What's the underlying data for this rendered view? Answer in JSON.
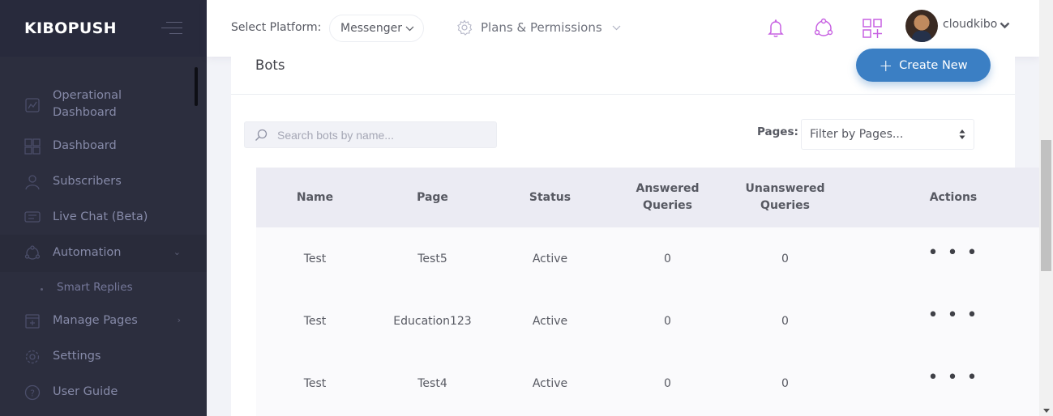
{
  "app": {
    "brand": "KIBOPUSH"
  },
  "sidebar": {
    "items": [
      {
        "label_line1": "Operational",
        "label_line2": "Dashboard",
        "icon": "chart-icon"
      },
      {
        "label": "Dashboard",
        "icon": "dashboard-grid-icon"
      },
      {
        "label": "Subscribers",
        "icon": "user-icon"
      },
      {
        "label": "Live Chat (Beta)",
        "icon": "chat-icon"
      },
      {
        "label": "Automation",
        "icon": "network-icon"
      },
      {
        "label": "Manage Pages",
        "icon": "page-icon"
      },
      {
        "label": "Settings",
        "icon": "gear-icon"
      },
      {
        "label": "User Guide",
        "icon": "help-icon"
      }
    ],
    "automation_sub": [
      {
        "label": "Smart Replies"
      }
    ]
  },
  "header": {
    "select_platform_label": "Select Platform:",
    "platform_value": "Messenger",
    "plans_label": "Plans & Permissions",
    "username": "cloudkibo",
    "icon_color": "#c761e2"
  },
  "portlet": {
    "title": "Bots",
    "create_label": "Create New",
    "search_placeholder": "Search bots by name...",
    "pages_label": "Pages:",
    "pages_filter": "Filter by Pages..."
  },
  "table": {
    "columns": [
      {
        "line1": "Name",
        "line2": ""
      },
      {
        "line1": "Page",
        "line2": ""
      },
      {
        "line1": "Status",
        "line2": ""
      },
      {
        "line1": "Answered",
        "line2": "Queries"
      },
      {
        "line1": "Unanswered",
        "line2": "Queries"
      },
      {
        "line1": "Actions",
        "line2": ""
      }
    ],
    "rows": [
      {
        "name": "Test",
        "page": "Test5",
        "status": "Active",
        "answered": "0",
        "unanswered": "0",
        "actions": "• • •"
      },
      {
        "name": "Test",
        "page": "Education123",
        "status": "Active",
        "answered": "0",
        "unanswered": "0",
        "actions": "• • •"
      },
      {
        "name": "Test",
        "page": "Test4",
        "status": "Active",
        "answered": "0",
        "unanswered": "0",
        "actions": "• • •"
      }
    ]
  }
}
